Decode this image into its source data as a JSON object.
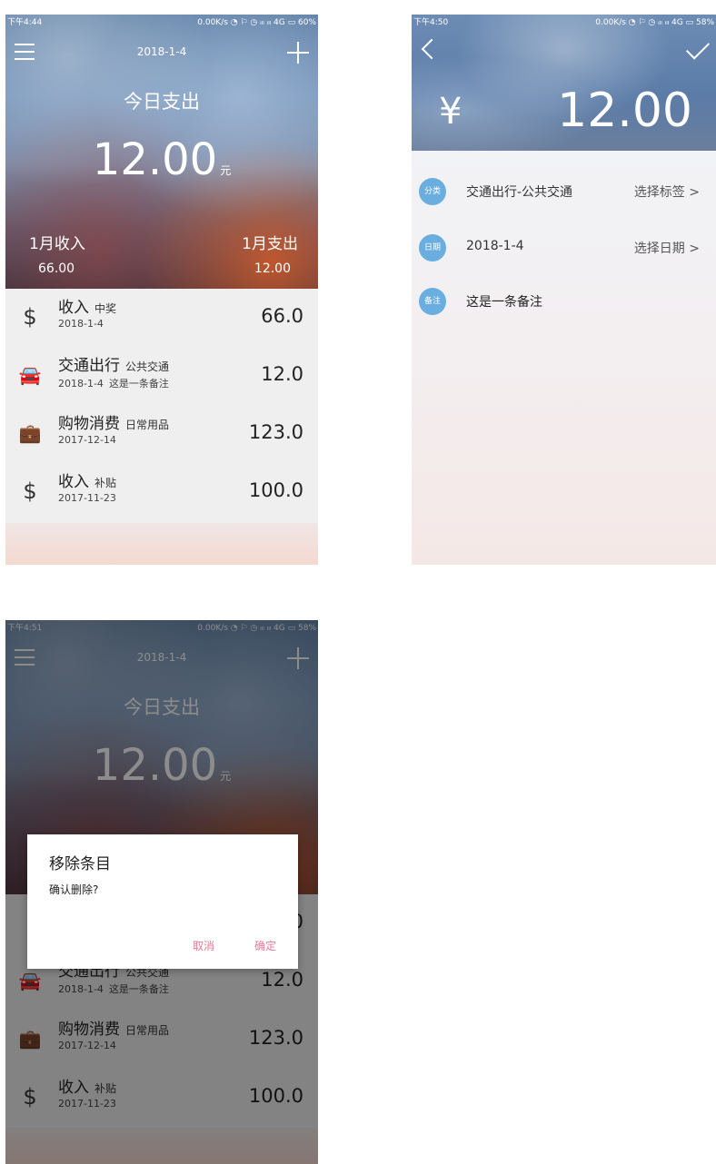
{
  "screen1": {
    "status": {
      "time": "下午4:44",
      "info": "0.00K/s ◔ ⚐ ◷ ᵢₗₗ ᵢₗₗ 4G ▭ 60%"
    },
    "header": {
      "date": "2018-1-4",
      "title": "今日支出",
      "amount": "12.00",
      "unit": "元"
    },
    "month": {
      "income_label": "1月收入",
      "expense_label": "1月支出",
      "income": "66.00",
      "expense": "12.00"
    },
    "entries": [
      {
        "icon": "dollar-icon",
        "glyph": "$",
        "name": "收入",
        "tag": "中奖",
        "date": "2018-1-4",
        "note": "",
        "amount": "66.0"
      },
      {
        "icon": "car-icon",
        "glyph": "🚘",
        "name": "交通出行",
        "tag": "公共交通",
        "date": "2018-1-4",
        "note": "这是一条备注",
        "amount": "12.0"
      },
      {
        "icon": "briefcase-icon",
        "glyph": "💼",
        "name": "购物消费",
        "tag": "日常用品",
        "date": "2017-12-14",
        "note": "",
        "amount": "123.0"
      },
      {
        "icon": "dollar-icon",
        "glyph": "$",
        "name": "收入",
        "tag": "补贴",
        "date": "2017-11-23",
        "note": "",
        "amount": "100.0"
      }
    ]
  },
  "screen2": {
    "status": {
      "time": "下午4:50",
      "info": "0.00K/s ◔ ⚐ ◷ ᵢₗₗ ᵢₗₗ 4G ▭ 58%"
    },
    "currency": "¥",
    "amount": "12.00",
    "fields": [
      {
        "badge": "分类",
        "value": "交通出行-公共交通",
        "action": "选择标签 >"
      },
      {
        "badge": "日期",
        "value": "2018-1-4",
        "action": "选择日期 >"
      },
      {
        "badge": "备注",
        "value": "这是一条备注",
        "action": ""
      }
    ]
  },
  "screen3": {
    "status": {
      "time": "下午4:51",
      "info": "0.00K/s ◔ ⚐ ◷ ᵢₗₗ ᵢₗₗ 4G ▭ 58%"
    },
    "dialog": {
      "title": "移除条目",
      "message": "确认删除?",
      "cancel": "取消",
      "confirm": "确定"
    },
    "partial_amount": "0"
  }
}
